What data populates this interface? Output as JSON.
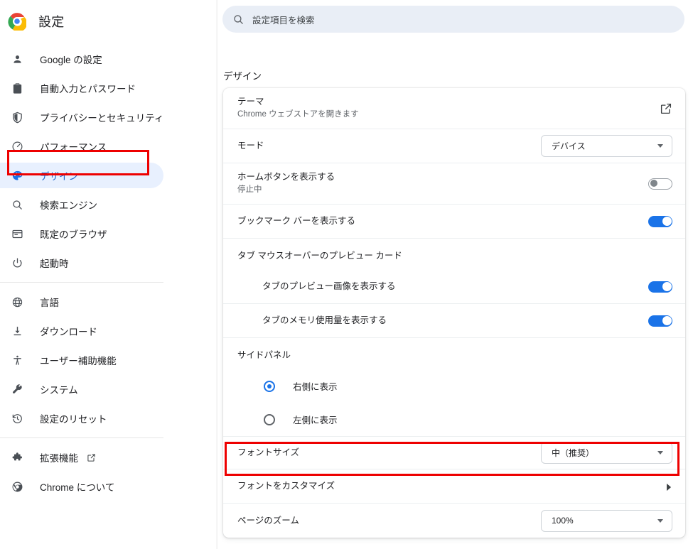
{
  "app": {
    "title": "設定",
    "logo_icon": "chrome-logo"
  },
  "search": {
    "placeholder": "設定項目を検索",
    "icon": "search-icon"
  },
  "sidebar": {
    "items": [
      {
        "label": "Google の設定",
        "icon": "person-icon",
        "selected": false
      },
      {
        "label": "自動入力とパスワード",
        "icon": "clipboard-icon",
        "selected": false
      },
      {
        "label": "プライバシーとセキュリティ",
        "icon": "shield-icon",
        "selected": false
      },
      {
        "label": "パフォーマンス",
        "icon": "speedometer-icon",
        "selected": false
      },
      {
        "label": "デザイン",
        "icon": "palette-icon",
        "selected": true
      },
      {
        "label": "検索エンジン",
        "icon": "search-icon",
        "selected": false
      },
      {
        "label": "既定のブラウザ",
        "icon": "browser-window-icon",
        "selected": false
      },
      {
        "label": "起動時",
        "icon": "power-icon",
        "selected": false
      },
      {
        "label": "言語",
        "icon": "globe-icon",
        "selected": false
      },
      {
        "label": "ダウンロード",
        "icon": "download-icon",
        "selected": false
      },
      {
        "label": "ユーザー補助機能",
        "icon": "accessibility-icon",
        "selected": false
      },
      {
        "label": "システム",
        "icon": "wrench-icon",
        "selected": false
      },
      {
        "label": "設定のリセット",
        "icon": "history-restore-icon",
        "selected": false
      },
      {
        "label": "拡張機能",
        "icon": "puzzle-icon",
        "selected": false,
        "external": true
      },
      {
        "label": "Chrome について",
        "icon": "chrome-outline-icon",
        "selected": false
      }
    ]
  },
  "main": {
    "section_title": "デザイン",
    "rows": {
      "theme": {
        "label": "テーマ",
        "sublabel": "Chrome ウェブストアを開きます",
        "icon": "open-in-new-icon"
      },
      "mode": {
        "label": "モード",
        "value": "デバイス"
      },
      "home_button": {
        "label": "ホームボタンを表示する",
        "sublabel": "停止中",
        "toggle": "off"
      },
      "bookmarks_bar": {
        "label": "ブックマーク バーを表示する",
        "toggle": "on"
      },
      "tab_preview_group": {
        "label": "タブ マウスオーバーのプレビュー カード"
      },
      "tab_preview_image": {
        "label": "タブのプレビュー画像を表示する",
        "toggle": "on"
      },
      "tab_memory_usage": {
        "label": "タブのメモリ使用量を表示する",
        "toggle": "on"
      },
      "side_panel_group": {
        "label": "サイドパネル"
      },
      "side_panel_right": {
        "label": "右側に表示",
        "checked": true
      },
      "side_panel_left": {
        "label": "左側に表示",
        "checked": false
      },
      "font_size": {
        "label": "フォントサイズ",
        "value": "中（推奨）"
      },
      "customize_fonts": {
        "label": "フォントをカスタマイズ",
        "icon": "chevron-right-icon"
      },
      "page_zoom": {
        "label": "ページのズーム",
        "value": "100%"
      }
    }
  },
  "highlights": {
    "design_nav": "デザイン",
    "font_size_row": "フォントサイズ"
  },
  "colors": {
    "accent": "#1a73e8",
    "selected_bg": "#e8f0fe",
    "highlight": "#ee0000",
    "search_bg": "#e9eef6",
    "text": "#202124",
    "muted_text": "#5f6368"
  }
}
